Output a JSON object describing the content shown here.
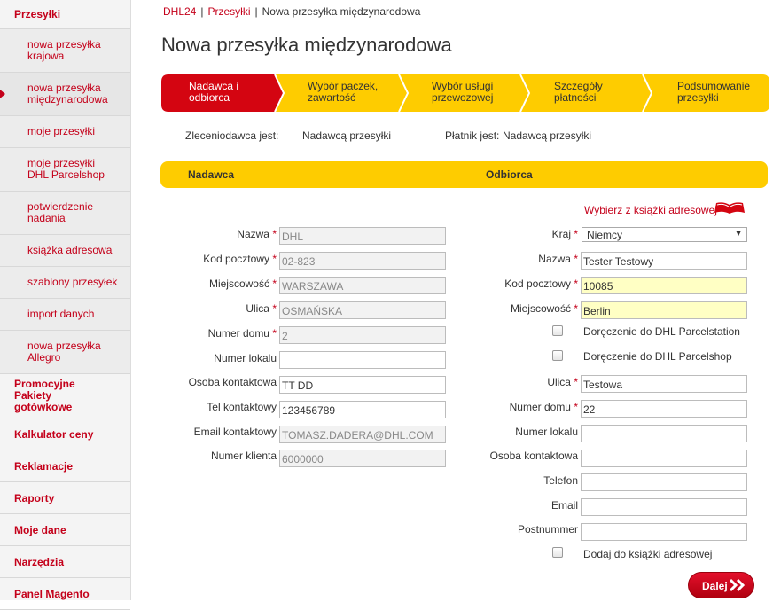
{
  "sidebar": {
    "items": [
      {
        "label": "Przesyłki",
        "type": "main"
      },
      {
        "label": "nowa przesyłka krajowa",
        "type": "sub"
      },
      {
        "label": "nowa przesyłka międzynarodowa",
        "type": "sub",
        "active": true
      },
      {
        "label": "moje przesyłki",
        "type": "sub"
      },
      {
        "label": "moje przesyłki DHL Parcelshop",
        "type": "sub"
      },
      {
        "label": "potwierdzenie nadania",
        "type": "sub"
      },
      {
        "label": "książka adresowa",
        "type": "sub"
      },
      {
        "label": "szablony przesyłek",
        "type": "sub"
      },
      {
        "label": "import danych",
        "type": "sub"
      },
      {
        "label": "nowa przesyłka Allegro",
        "type": "sub"
      },
      {
        "label": "Promocyjne Pakiety gotówkowe",
        "type": "main"
      },
      {
        "label": "Kalkulator ceny",
        "type": "main"
      },
      {
        "label": "Reklamacje",
        "type": "main"
      },
      {
        "label": "Raporty",
        "type": "main"
      },
      {
        "label": "Moje dane",
        "type": "main"
      },
      {
        "label": "Narzędzia",
        "type": "main"
      },
      {
        "label": "Panel Magento",
        "type": "main"
      }
    ]
  },
  "breadcrumb": {
    "home": "DHL24",
    "section": "Przesyłki",
    "current": "Nowa przesyłka międzynarodowa",
    "separator": "|"
  },
  "page_title": "Nowa przesyłka międzynarodowa",
  "steps": [
    {
      "label": "Nadawca i odbiorca",
      "active": true
    },
    {
      "label": "Wybór paczek, zawartość"
    },
    {
      "label": "Wybór usługi przewozowej"
    },
    {
      "label": "Szczegóły płatności"
    },
    {
      "label": "Podsumowanie przesyłki"
    }
  ],
  "info": {
    "ordering_label": "Zleceniodawca jest:",
    "ordering_value": "Nadawcą przesyłki",
    "payer_label": "Płatnik jest:",
    "payer_value": "Nadawcą przesyłki"
  },
  "sections": {
    "sender": "Nadawca",
    "receiver": "Odbiorca"
  },
  "address_book_link": "Wybierz z książki adresowej",
  "sender": {
    "name_label": "Nazwa",
    "name_value": "DHL",
    "postcode_label": "Kod pocztowy",
    "postcode_value": "02-823",
    "city_label": "Miejscowość",
    "city_value": "WARSZAWA",
    "street_label": "Ulica",
    "street_value": "OSMAŃSKA",
    "house_label": "Numer domu",
    "house_value": "2",
    "apt_label": "Numer lokalu",
    "apt_value": "",
    "contact_label": "Osoba kontaktowa",
    "contact_value": "TT DD",
    "phone_label": "Tel kontaktowy",
    "phone_value": "123456789",
    "email_label": "Email kontaktowy",
    "email_value": "TOMASZ.DADERA@DHL.COM",
    "client_label": "Numer klienta",
    "client_value": "6000000"
  },
  "receiver": {
    "country_label": "Kraj",
    "country_value": "Niemcy",
    "name_label": "Nazwa",
    "name_value": "Tester Testowy",
    "postcode_label": "Kod pocztowy",
    "postcode_value": "10085",
    "city_label": "Miejscowość",
    "city_value": "Berlin",
    "parcelstation_label": "Doręczenie do DHL Parcelstation",
    "parcelshop_label": "Doręczenie do DHL Parcelshop",
    "street_label": "Ulica",
    "street_value": "Testowa",
    "house_label": "Numer domu",
    "house_value": "22",
    "apt_label": "Numer lokalu",
    "apt_value": "",
    "contact_label": "Osoba kontaktowa",
    "contact_value": "",
    "phone_label": "Telefon",
    "phone_value": "",
    "email_label": "Email",
    "email_value": "",
    "postnummer_label": "Postnummer",
    "postnummer_value": "",
    "add_to_book_label": "Dodaj do książki adresowej"
  },
  "required_mark": "*",
  "next_button": "Dalej",
  "colors": {
    "brand_red": "#c4001a",
    "brand_yellow": "#fecc00",
    "highlight_input": "#ffffc4"
  }
}
